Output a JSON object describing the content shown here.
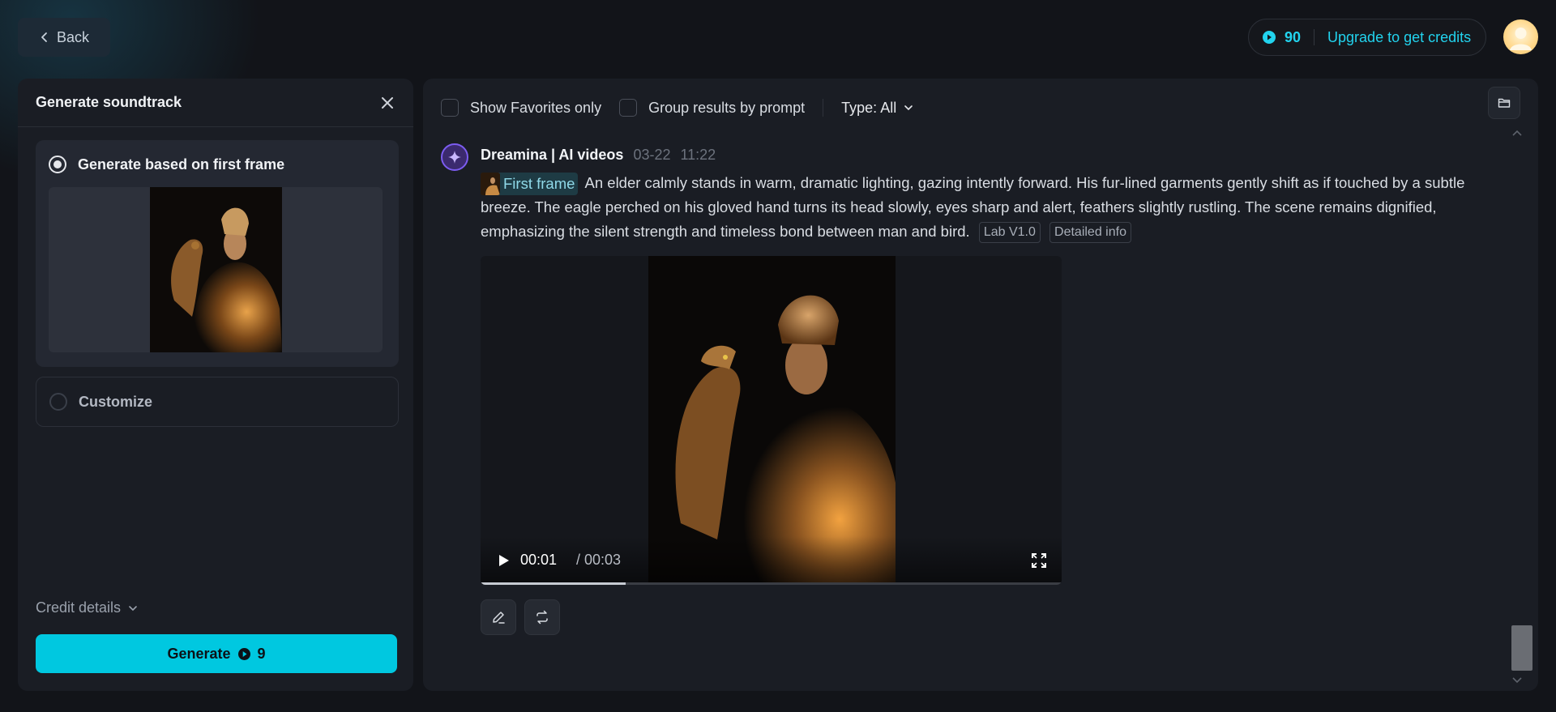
{
  "top": {
    "back_label": "Back",
    "credits_count": "90",
    "upgrade_label": "Upgrade to get credits"
  },
  "left_panel": {
    "title": "Generate soundtrack",
    "option_first_frame": "Generate based on first frame",
    "option_customize": "Customize",
    "selected_option": "Generate based on first frame",
    "credit_details_label": "Credit details",
    "generate_label": "Generate",
    "generate_cost": "9"
  },
  "toolbar": {
    "favorites_label": "Show Favorites only",
    "group_label": "Group results by prompt",
    "type_label": "Type: All"
  },
  "post": {
    "author": "Dreamina | AI videos",
    "date": "03-22",
    "time": "11:22",
    "first_frame_chip": "First frame",
    "prompt_text": "An elder calmly stands in warm, dramatic lighting, gazing intently forward. His fur-lined garments gently shift as if touched by a subtle breeze. The eagle perched on his gloved hand turns its head slowly, eyes sharp and alert, feathers slightly rustling. The scene remains dignified, emphasizing the silent strength and timeless bond between man and bird.",
    "tag_model": "Lab V1.0",
    "tag_details": "Detailed info"
  },
  "video": {
    "current_time": "00:01",
    "total_time": "/ 00:03",
    "progress": 0.25
  },
  "colors": {
    "accent": "#00c8e0",
    "credit_text": "#22d3ee",
    "background": "#121419",
    "panel": "#1a1d24"
  },
  "icons": [
    "chevron-left-icon",
    "coin-icon",
    "close-icon",
    "chevron-down-icon",
    "folder-icon",
    "play-icon",
    "fullscreen-icon",
    "edit-icon",
    "regenerate-icon",
    "sparkle-icon"
  ]
}
